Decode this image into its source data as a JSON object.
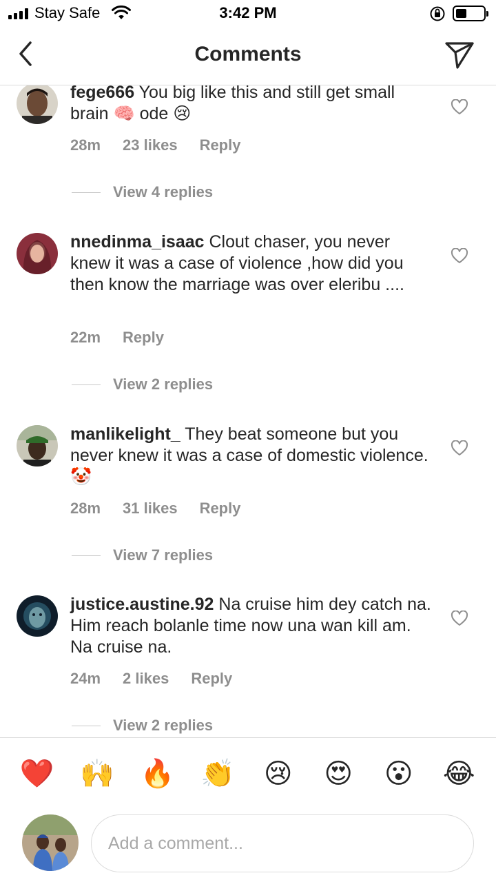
{
  "status_bar": {
    "carrier": "Stay Safe",
    "time": "3:42 PM",
    "signal_bars": 4,
    "battery_level": 0.35
  },
  "header": {
    "title": "Comments",
    "back_icon": "chevron-left-icon",
    "send_icon": "send-icon"
  },
  "comments": [
    {
      "username": "fege666",
      "text": " You big like this and still get small brain 🧠 ode 😢",
      "time": "28m",
      "likes": "23 likes",
      "reply_label": "Reply",
      "view_replies": "View 4 replies"
    },
    {
      "username": "nnedinma_isaac",
      "text": " Clout chaser, you never knew it was a case of violence ,how did you then know the marriage was over eleribu ....",
      "time": "22m",
      "likes": "",
      "reply_label": "Reply",
      "view_replies": "View 2 replies"
    },
    {
      "username": "manlikelight_",
      "text": " They beat someone but you never knew it was a case of domestic violence.🤡",
      "time": "28m",
      "likes": "31 likes",
      "reply_label": "Reply",
      "view_replies": "View 7 replies"
    },
    {
      "username": "justice.austine.92",
      "text": " Na cruise him dey catch na. Him reach bolanle time now una wan kill am. Na cruise na.",
      "time": "24m",
      "likes": "2 likes",
      "reply_label": "Reply",
      "view_replies": "View 2 replies"
    }
  ],
  "emoji_bar": [
    "❤️",
    "🙌",
    "🔥",
    "👏",
    "😢",
    "😍",
    "😮",
    "😂"
  ],
  "input": {
    "placeholder": "Add a comment..."
  },
  "colors": {
    "text": "#262626",
    "secondary": "#8e8e8e",
    "border": "#dbdbdb"
  }
}
